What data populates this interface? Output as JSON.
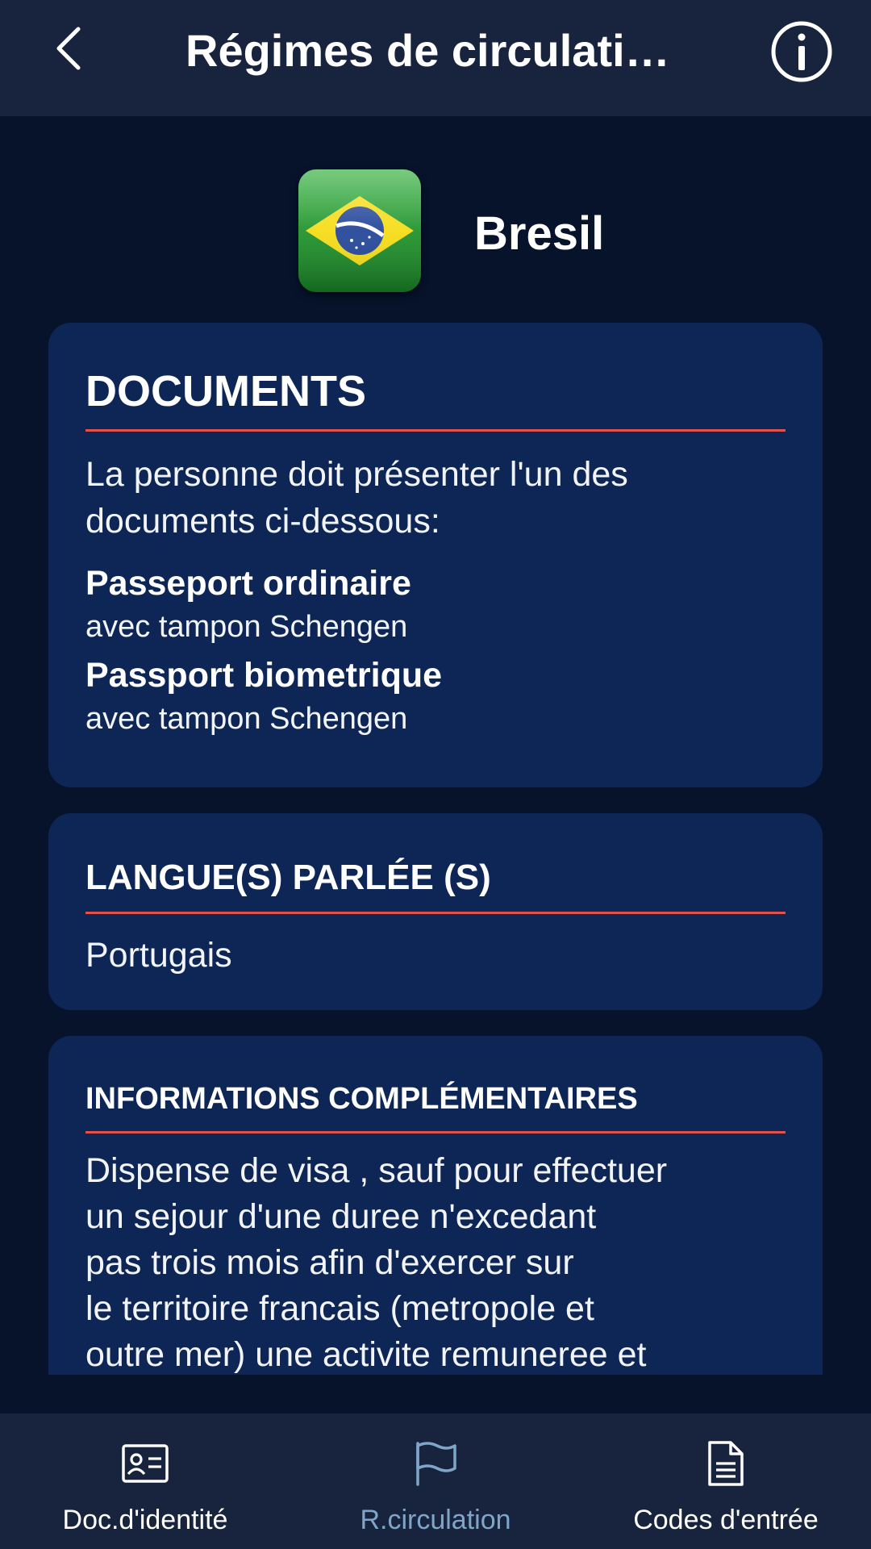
{
  "header": {
    "title": "Régimes de circulati…",
    "back_icon": "chevron-left-icon",
    "info_icon": "info-circle-icon"
  },
  "country": {
    "name": "Bresil",
    "flag_icon": "brazil-flag-icon"
  },
  "documents": {
    "title": "DOCUMENTS",
    "intro": "La personne doit présenter l'un des documents ci-dessous:",
    "items": [
      {
        "name": "Passeport ordinaire",
        "note": "avec tampon Schengen"
      },
      {
        "name": "Passport biometrique",
        "note": "avec tampon Schengen"
      }
    ]
  },
  "languages": {
    "title": "LANGUE(S) PARLÉE (S)",
    "value": "Portugais"
  },
  "additional_info": {
    "title": "INFORMATIONS COMPLÉMENTAIRES",
    "lines": [
      "Dispense de visa , sauf pour effectuer",
      "un sejour d'une duree n'excedant",
      "pas trois mois afin d'exercer sur",
      "le territoire francais (metropole et",
      "outre mer) une activite remuneree et"
    ]
  },
  "bottom_nav": {
    "items": [
      {
        "label": "Doc.d'identité",
        "icon": "id-card-icon",
        "active": false
      },
      {
        "label": "R.circulation",
        "icon": "flag-icon",
        "active": true
      },
      {
        "label": "Codes d'entrée",
        "icon": "document-icon",
        "active": false
      }
    ]
  },
  "colors": {
    "background": "#06132b",
    "bar": "#18233d",
    "card": "#0e2656",
    "accent_line": "#e0524a",
    "active_nav": "#7fa6c8"
  }
}
